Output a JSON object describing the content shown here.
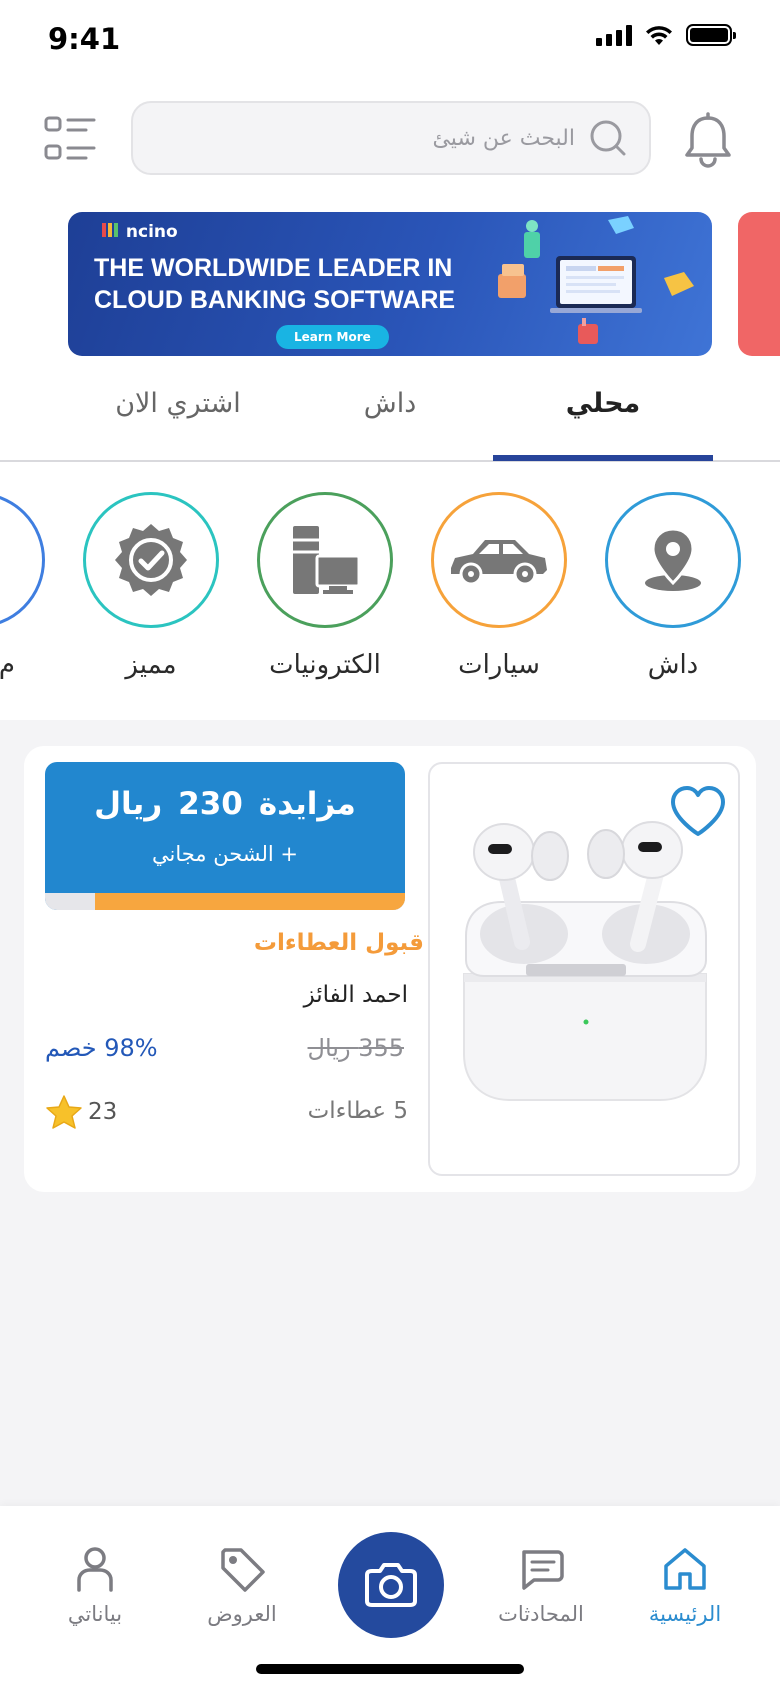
{
  "status_bar": {
    "time": "9:41"
  },
  "header": {
    "search_placeholder": "البحث عن شيئ"
  },
  "banner": {
    "brand": "ncino",
    "headline": "THE WORLDWIDE LEADER IN CLOUD BANKING SOFTWARE",
    "cta": "Learn More"
  },
  "tabs": [
    {
      "label": "محلي",
      "active": true
    },
    {
      "label": "داش",
      "active": false
    },
    {
      "label": "اشتري الان",
      "active": false
    }
  ],
  "categories": [
    {
      "label": "داش",
      "icon": "location-pin-icon",
      "color": "#2f9bd8"
    },
    {
      "label": "سيارات",
      "icon": "car-icon",
      "color": "#f6a23a"
    },
    {
      "label": "الكترونيات",
      "icon": "electronics-icon",
      "color": "#4ba05c"
    },
    {
      "label": "مميز",
      "icon": "verified-badge-icon",
      "color": "#2bc4c0"
    },
    {
      "label": "م",
      "icon": "category-icon",
      "color": "#3f7ee0"
    }
  ],
  "product": {
    "auction_label": "مزايدة",
    "price": "230",
    "currency": "ريال",
    "shipping": "+ الشحن مجاني",
    "progress": 0.86,
    "bid_status": "قبول العطاءات",
    "seller": "احمد الفائز",
    "old_price": "355 ريال",
    "discount": "98% خصم",
    "bids_count": "5 عطاءات",
    "rating_count": "23",
    "image": "airpods-icon",
    "favorite": false
  },
  "nav": {
    "home": "الرئيسية",
    "chats": "المحادثات",
    "offers": "العروض",
    "profile": "بياناتي"
  },
  "colors": {
    "primary": "#244a9e",
    "accent_blue": "#2287cf",
    "orange": "#f49b3a",
    "discount_blue": "#2358b8"
  }
}
